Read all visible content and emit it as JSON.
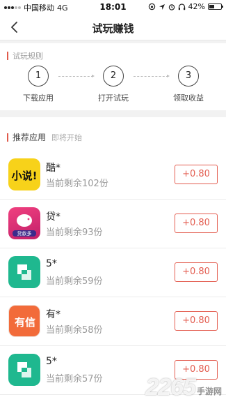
{
  "status_bar": {
    "carrier": "中国移动",
    "network": "4G",
    "time": "18:01",
    "battery": "42%",
    "battery_level": 0.42
  },
  "nav": {
    "title": "试玩赚钱"
  },
  "rules": {
    "title": "试玩规则",
    "steps": [
      {
        "number": "1",
        "label": "下载应用"
      },
      {
        "number": "2",
        "label": "打开试玩"
      },
      {
        "number": "3",
        "label": "领取收益"
      }
    ]
  },
  "recommend": {
    "title": "推荐应用",
    "subtitle": "即将开始",
    "apps": [
      {
        "name": "酷*",
        "remaining": "当前剩余102份",
        "reward": "+0.80",
        "icon": "xiaoshuo-app-icon"
      },
      {
        "name": "贷*",
        "remaining": "当前剩余93份",
        "reward": "+0.80",
        "icon": "daikuan-app-icon"
      },
      {
        "name": "5*",
        "remaining": "当前剩余59份",
        "reward": "+0.80",
        "icon": "green-app-icon"
      },
      {
        "name": "有*",
        "remaining": "当前剩余58份",
        "reward": "+0.80",
        "icon": "youxin-app-icon"
      },
      {
        "name": "5*",
        "remaining": "当前剩余57份",
        "reward": "+0.80",
        "icon": "green-app-icon"
      }
    ]
  },
  "watermark": {
    "number": "2265",
    "suffix": "手游网"
  },
  "colors": {
    "accent": "#e35d50",
    "green_icon": "#1fb88f",
    "yellow_icon": "#f7d21a",
    "pink_icon": "#e8327a",
    "orange_icon": "#f26b3a"
  }
}
